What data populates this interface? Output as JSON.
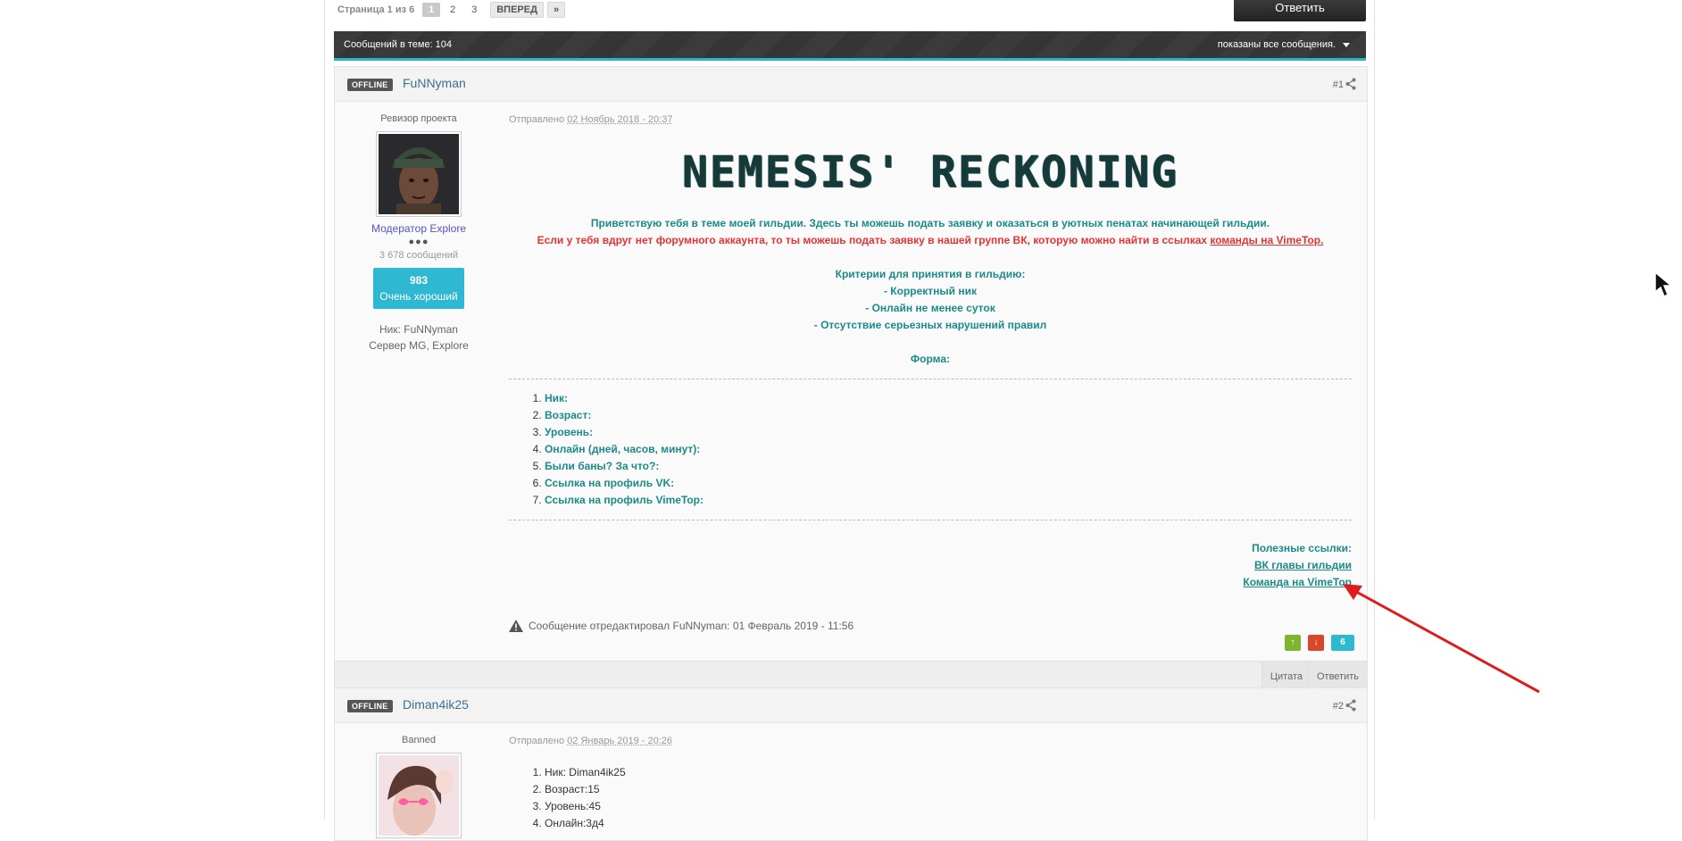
{
  "pagination": {
    "label": "Страница 1 из 6",
    "pages": [
      "1",
      "2",
      "3"
    ],
    "next_label": "ВПЕРЕД",
    "last_label": "»"
  },
  "reply_top_label": "Ответить",
  "thread_bar": {
    "count_label": "Сообщений в теме: 104",
    "filter_label": "показаны все сообщения."
  },
  "post1": {
    "status": "OFFLINE",
    "author": "FuNNyman",
    "number": "#1",
    "user_title": "Ревизор проекта",
    "group": "Модератор Explore",
    "pips": "●●●",
    "posts_count": "3 678 сообщений",
    "rep_value": "983",
    "rep_label": "Очень хороший",
    "info_nick": "Ник: FuNNyman",
    "info_server": "Сервер MG, Explore",
    "posted_prefix": "Отправлено ",
    "posted_date": "02 Ноябрь 2018 - 20:37",
    "title": "NEMESIS' RECKONING",
    "greeting": "Приветствую тебя в теме моей гильдии. Здесь ты можешь подать заявку и оказаться в уютных пенатах начинающей гильдии.",
    "no_account": "Если у тебя вдруг нет форумного аккаунта, то ты можешь подать заявку в нашей группе ВК, которую можно найти в ссылках ",
    "no_account_link": "команды на VimeTop.",
    "criteria_title": "Критерии для принятия в гильдию:",
    "criteria": [
      "- Корректный ник",
      "- Онлайн не менее суток",
      "- Отсутствие серьезных нарушений правил"
    ],
    "form_title": "Форма:",
    "form_fields": [
      "Ник:",
      "Возраст:",
      "Уровень:",
      "Онлайн (дней, часов, минут):",
      "Были баны? За что?:",
      "Ссылка на профиль VK:",
      "Ссылка на профиль VimeTop:"
    ],
    "links_title": "Полезные ссылки:",
    "link_vk": "ВК главы гильдии",
    "link_vimetop": "Команда на VimeTop",
    "edit_note": "Сообщение отредактировал FuNNyman: 01 Февраль 2019 - 11:56",
    "vote_up": "↑",
    "vote_down": "↓",
    "vote_count": "6",
    "quote_label": "Цитата",
    "reply_label": "Ответить"
  },
  "post2": {
    "status": "OFFLINE",
    "author": "Diman4ik25",
    "number": "#2",
    "user_title": "Banned",
    "posted_prefix": "Отправлено ",
    "posted_date": "02 Январь 2019 - 20:26",
    "answers": [
      "Ник: Diman4ik25",
      "Возраст:15",
      "Уровень:45",
      "Онлайн:3д4"
    ]
  },
  "colors": {
    "accent": "#27b5c9",
    "teal_text": "#1c8a8a",
    "red_text": "#e53333",
    "annotation_arrow": "#e01b1b"
  }
}
